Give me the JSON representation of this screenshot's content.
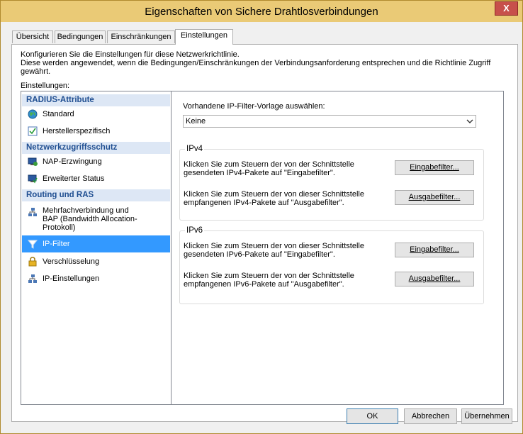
{
  "window": {
    "title": "Eigenschaften von Sichere Drahtlosverbindungen",
    "close_glyph": "X"
  },
  "tabs": [
    {
      "label": "Übersicht"
    },
    {
      "label": "Bedingungen"
    },
    {
      "label": "Einschränkungen"
    },
    {
      "label": "Einstellungen",
      "active": true
    }
  ],
  "description": {
    "line1": "Konfigurieren Sie die Einstellungen für diese Netzwerkrichtlinie.",
    "line2": "Diese werden angewendet, wenn die Bedingungen/Einschränkungen der Verbindungsanforderung entsprechen und die Richtlinie Zugriff gewährt."
  },
  "settings_label": "Einstellungen:",
  "settings_tree": {
    "categories": [
      {
        "label": "RADIUS-Attribute"
      },
      {
        "label": "Netzwerkzugriffsschutz"
      },
      {
        "label": "Routing und RAS"
      }
    ],
    "items": [
      {
        "label": "Standard",
        "icon": "globe-icon"
      },
      {
        "label": "Herstellerspezifisch",
        "icon": "checkbox-doc-icon"
      },
      {
        "label": "NAP-Erzwingung",
        "icon": "nap-monitor-icon"
      },
      {
        "label": "Erweiterter Status",
        "icon": "status-monitor-icon"
      },
      {
        "label": "Mehrfachverbindung und",
        "label2": "BAP (Bandwidth Allocation-",
        "label3": "Protokoll)",
        "icon": "network-icon"
      },
      {
        "label": "IP-Filter",
        "icon": "filter-icon",
        "selected": true
      },
      {
        "label": "Verschlüsselung",
        "icon": "lock-icon"
      },
      {
        "label": "IP-Einstellungen",
        "icon": "network-icon"
      }
    ]
  },
  "filter_panel": {
    "template_label": "Vorhandene IP-Filter-Vorlage auswählen:",
    "template_value": "Keine",
    "ipv4": {
      "title": "IPv4",
      "input_text1": "Klicken Sie zum Steuern der von der Schnittstelle",
      "input_text2": "gesendeten IPv4-Pakete auf \"Eingabefilter\".",
      "input_button": "Eingabefilter...",
      "output_text1": "Klicken Sie zum Steuern der von dieser Schnittstelle",
      "output_text2": "empfangenen IPv4-Pakete auf \"Ausgabefilter\".",
      "output_button": "Ausgabefilter..."
    },
    "ipv6": {
      "title": "IPv6",
      "input_text1": "Klicken Sie zum Steuern der von dieser Schnittstelle",
      "input_text2": "gesendeten IPv6-Pakete auf \"Eingabefilter\".",
      "input_button": "Eingabefilter...",
      "output_text1": "Klicken Sie zum Steuern der von der Schnittstelle",
      "output_text2": "empfangenen IPv6-Pakete auf \"Ausgabefilter\".",
      "output_button": "Ausgabefilter..."
    }
  },
  "buttons": {
    "ok": "OK",
    "cancel": "Abbrechen",
    "apply": "Übernehmen"
  }
}
